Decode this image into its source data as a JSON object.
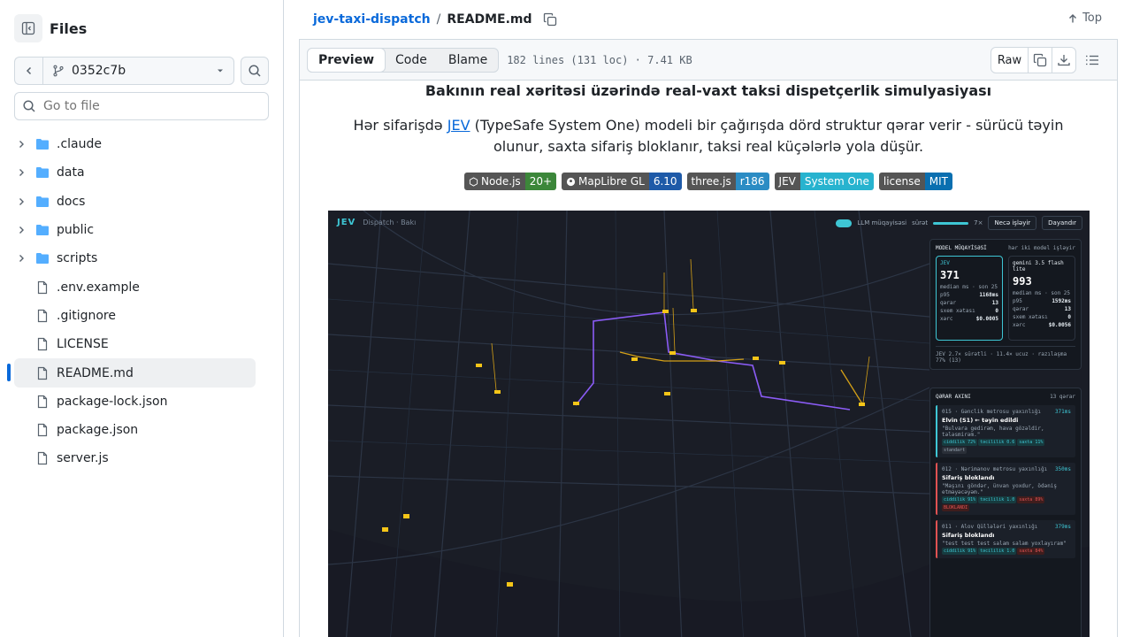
{
  "sidebar": {
    "title": "Files",
    "branch": "0352c7b",
    "goto_placeholder": "Go to file",
    "folders": [
      ".claude",
      "data",
      "docs",
      "public",
      "scripts"
    ],
    "files": [
      ".env.example",
      ".gitignore",
      "LICENSE",
      "README.md",
      "package-lock.json",
      "package.json",
      "server.js"
    ],
    "active_file": "README.md"
  },
  "header": {
    "repo": "jev-taxi-dispatch",
    "separator": "/",
    "file": "README.md",
    "top_label": "Top"
  },
  "toolbar": {
    "tabs": [
      "Preview",
      "Code",
      "Blame"
    ],
    "active_tab": "Preview",
    "file_info": "182 lines (131 loc) · 7.41 KB",
    "raw_label": "Raw"
  },
  "readme": {
    "subtitle": "Bakının real xəritəsi üzərində real-vaxt taksi dispetçerlik simulyasiyası",
    "desc_before": "Hər sifarişdə ",
    "desc_link": "JEV",
    "desc_after": " (TypeSafe System One) modeli bir çağırışda dörd struktur qərar verir - sürücü təyin olunur, saxta sifariş bloklanır, taksi real küçələrlə yola düşür.",
    "badges": [
      {
        "left": "Node.js",
        "right": "20+",
        "color": "#3c873a"
      },
      {
        "left": "MapLibre GL",
        "right": "6.10",
        "color": "#1e5aa8"
      },
      {
        "left": "three.js",
        "right": "r186",
        "color": "#2b8cc4"
      },
      {
        "left": "JEV",
        "right": "System One",
        "color": "#27b3cf"
      },
      {
        "left": "license",
        "right": "MIT",
        "color": "#0a6fb0"
      }
    ]
  },
  "screenshot": {
    "logo": "JEV",
    "crumb": "Dispatch · Bakı",
    "toggle_label": "LLM müqayisəsi",
    "speed_label": "sürət",
    "speed_value": "7×",
    "how_btn": "Necə işləyir",
    "stop_btn": "Dayandır",
    "model_title": "MODEL MÜQAYİSƏSİ",
    "model_sub": "hər iki model işləyir",
    "jev": {
      "name": "JEV",
      "median": "371",
      "median_label": "median ms · son 25",
      "p95": "1168ms",
      "decisions": "13",
      "schema_err": "0",
      "cost": "$0.0005"
    },
    "gemini": {
      "name": "gemini 3.5 flash lite",
      "median": "993",
      "median_label": "median ms · son 25",
      "p95": "1592ms",
      "decisions": "13",
      "schema_err": "0",
      "cost": "$0.0056"
    },
    "row_labels": {
      "p95": "p95",
      "decisions": "qərar",
      "schema": "sxem xətası",
      "cost": "xərc"
    },
    "summary": "JEV 2.7× sürətli · 11.4× ucuz · razılaşma 77% (13)",
    "flow_title": "QƏRAR AXINI",
    "flow_count": "13 qərar",
    "decisions": [
      {
        "id": "015 · Gənclik metrosu yaxınlığı",
        "ms": "371ms",
        "title": "Elvin (S1) ← təyin edildi",
        "quote": "\"Bulvara gedirəm, hava gözəldir, tələsmirəm.\"",
        "chips": [
          "ciddilik 72%",
          "təcililik 0.6",
          "saxta 11%",
          "standart"
        ],
        "red": false
      },
      {
        "id": "012 · Nərimanov metrosu yaxınlığı",
        "ms": "350ms",
        "title": "Sifariş bloklandı",
        "quote": "\"Maşını göndər, ünvan yoxdur, ödəniş etməyəcəyəm.\"",
        "chips": [
          "ciddilik 91%",
          "təcililik 1.0",
          "saxta 89%",
          "BLOKLANDI"
        ],
        "red": true
      },
      {
        "id": "011 · Alov Qüllələri yaxınlığı",
        "ms": "379ms",
        "title": "Sifariş bloklandı",
        "quote": "\"test test test salam salam yoxlayıram\"",
        "chips": [
          "ciddilik 91%",
          "təcililik 1.0",
          "saxta 84%"
        ],
        "red": true
      }
    ]
  }
}
